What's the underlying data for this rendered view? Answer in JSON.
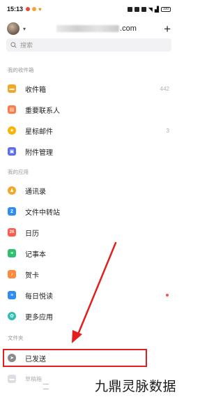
{
  "status_bar": {
    "time": "15:13",
    "battery": "100"
  },
  "account": {
    "email_suffix": ".com",
    "add_label": "+"
  },
  "search": {
    "placeholder": "搜索"
  },
  "sections": {
    "my_mailbox": "我的收件箱",
    "my_apps": "我的应用",
    "folders": "文件夹"
  },
  "mailbox_items": [
    {
      "label": "收件箱",
      "count": "442",
      "icon": "inbox-icon",
      "color": "#f5a623"
    },
    {
      "label": "重要联系人",
      "count": "",
      "icon": "contact-icon",
      "color": "#ff7a45"
    },
    {
      "label": "星标邮件",
      "count": "3",
      "icon": "star-icon",
      "color": "#f7b500"
    },
    {
      "label": "附件管理",
      "count": "",
      "icon": "attachment-icon",
      "color": "#5b6cf0"
    }
  ],
  "app_items": [
    {
      "label": "通讯录",
      "icon": "address-book-icon",
      "color": "#f5a623",
      "glyph": "♟"
    },
    {
      "label": "文件中转站",
      "icon": "file-transfer-icon",
      "color": "#2f8cf6",
      "glyph": "2"
    },
    {
      "label": "日历",
      "icon": "calendar-icon",
      "color": "#ff5a4e",
      "glyph": "26"
    },
    {
      "label": "记事本",
      "icon": "notepad-icon",
      "color": "#2fbf71",
      "glyph": "≡"
    },
    {
      "label": "贺卡",
      "icon": "greeting-card-icon",
      "color": "#ff8a3d",
      "glyph": "♪"
    },
    {
      "label": "每日悦读",
      "icon": "daily-reading-icon",
      "color": "#2f8cf6",
      "glyph": "≡"
    },
    {
      "label": "更多应用",
      "icon": "more-apps-icon",
      "color": "#2fbfb0",
      "glyph": "✿"
    }
  ],
  "folder_items": [
    {
      "label": "已发送",
      "icon": "sent-icon",
      "color": "#8a8a8a"
    }
  ],
  "next_item_partial": "草稿箱",
  "watermark": "九鼎灵脉数据",
  "accent": "#e11f1f"
}
